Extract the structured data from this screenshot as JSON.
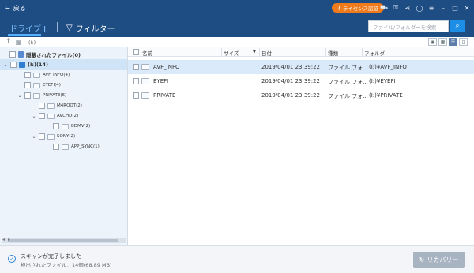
{
  "topbar": {
    "back_label": "戻る",
    "license_label": "ライセンス認証",
    "icons": [
      "cart-icon",
      "key-icon",
      "share-icon",
      "user-icon",
      "menu-icon",
      "minimize-icon",
      "restore-icon",
      "close-icon"
    ]
  },
  "tabs": {
    "drive_label": "ドライブ I",
    "filter_label": "フィルター"
  },
  "search": {
    "placeholder": "ファイル/フォルダーを検索"
  },
  "path": {
    "text": "(I:)"
  },
  "view_modes": [
    "preview",
    "grid",
    "list",
    "detail"
  ],
  "tree": {
    "deleted_files": "隠蔽されたファイル(0)",
    "drive": "(I:)(14)",
    "items": [
      {
        "label": "AVF_INFO(4)"
      },
      {
        "label": "EYEFI(4)"
      },
      {
        "label": "PRIVATE(6)"
      },
      {
        "label": "M4ROOT(2)"
      },
      {
        "label": "AVCHD(2)"
      },
      {
        "label": "BDMV(2)"
      },
      {
        "label": "SONY(2)"
      },
      {
        "label": "APP_SYNC(1)"
      }
    ]
  },
  "columns": {
    "name": "名前",
    "size": "サイズ",
    "date": "日付",
    "type": "種類",
    "folder": "フォルダ"
  },
  "rows": [
    {
      "name": "AVF_INFO",
      "size": "",
      "date": "2019/04/01 23:39:22",
      "type": "ファイル フォ...",
      "folder": "(I:)¥AVF_INFO"
    },
    {
      "name": "EYEFI",
      "size": "",
      "date": "2019/04/01 23:39:22",
      "type": "ファイル フォ...",
      "folder": "(I:)¥EYEFI"
    },
    {
      "name": "PRIVATE",
      "size": "",
      "date": "2019/04/01 23:39:22",
      "type": "ファイル フォ...",
      "folder": "(I:)¥PRIVATE"
    }
  ],
  "status": {
    "line1": "スキャンが完了しました",
    "line2": "検出されたファイル：14個(68.89 MB)"
  },
  "recover_label": "リカバリー",
  "colors": {
    "header_bg": "#1e4d84",
    "accent_orange": "#f07b1c",
    "accent_blue": "#1d8ee6",
    "selection": "#dbeafa"
  }
}
